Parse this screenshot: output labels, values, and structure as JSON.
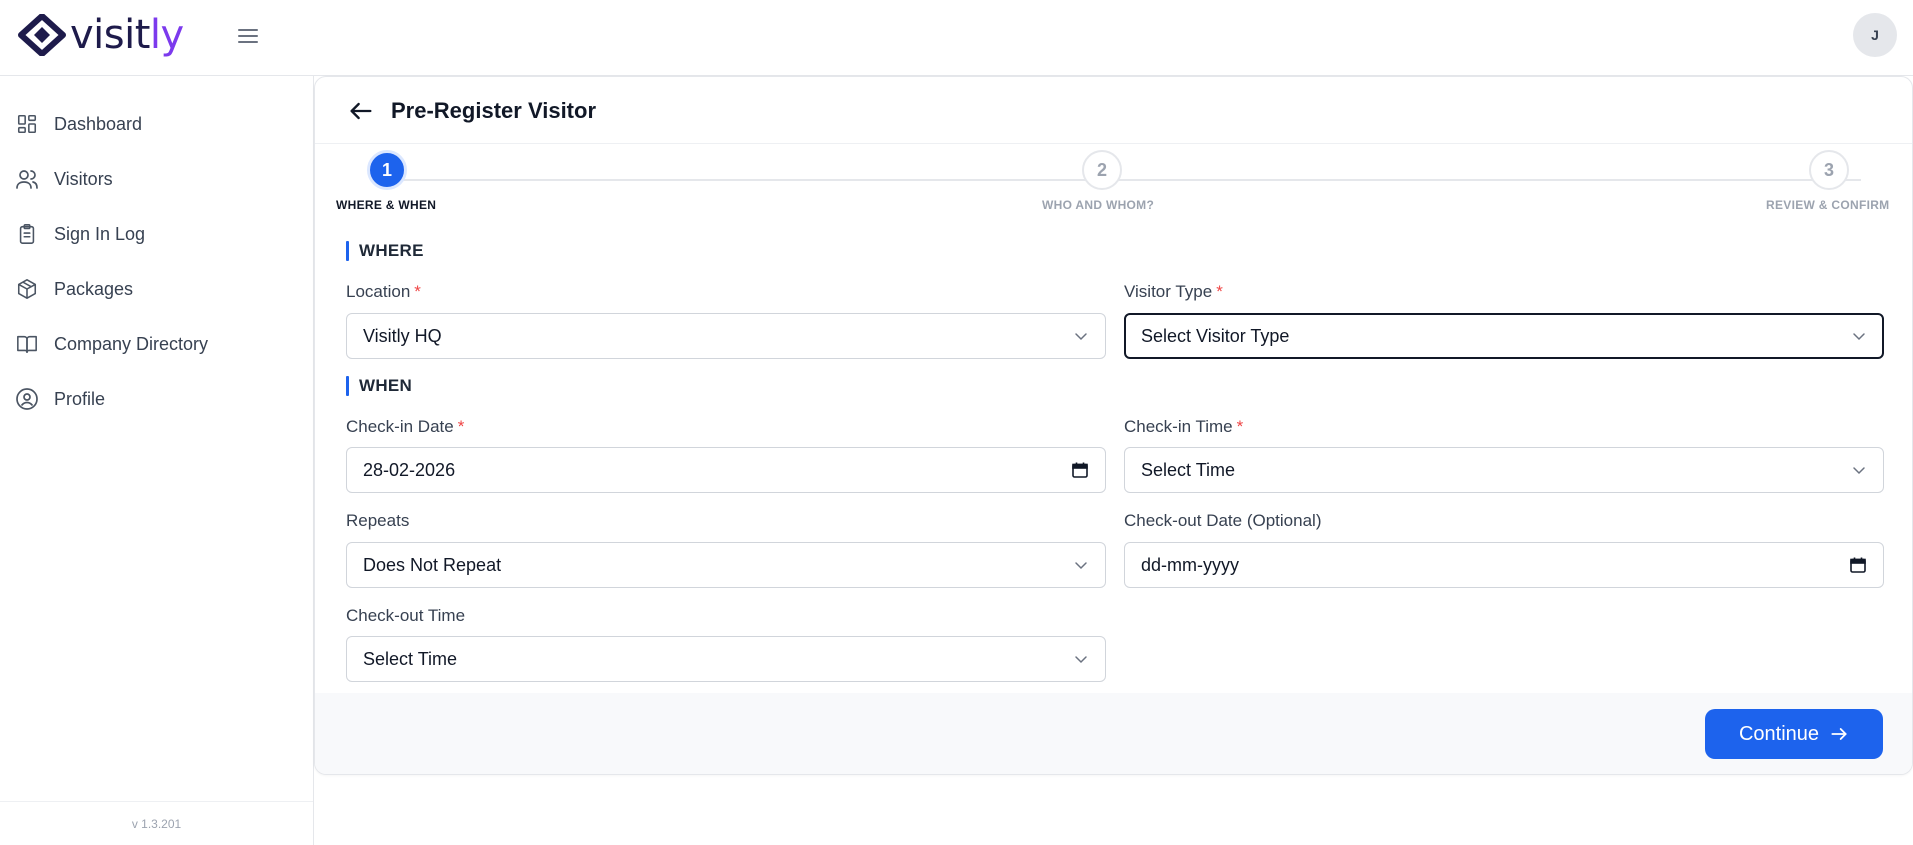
{
  "brand": {
    "name_main": "visit",
    "name_accent": "ly",
    "colors": {
      "navy": "#1e1b4b",
      "accent": "#7c3aed",
      "primary": "#1d63ed"
    }
  },
  "header": {
    "avatar_initial": "J"
  },
  "sidebar": {
    "items": [
      {
        "label": "Dashboard",
        "icon": "dashboard-icon"
      },
      {
        "label": "Visitors",
        "icon": "users-icon"
      },
      {
        "label": "Sign In Log",
        "icon": "clipboard-icon"
      },
      {
        "label": "Packages",
        "icon": "package-icon"
      },
      {
        "label": "Company Directory",
        "icon": "book-icon"
      },
      {
        "label": "Profile",
        "icon": "user-circle-icon"
      }
    ],
    "version": "v 1.3.201"
  },
  "page": {
    "title": "Pre-Register Visitor"
  },
  "stepper": {
    "current": 1,
    "steps": [
      {
        "number": "1",
        "label": "WHERE & WHEN"
      },
      {
        "number": "2",
        "label": "WHO AND WHOM?"
      },
      {
        "number": "3",
        "label": "REVIEW & CONFIRM"
      }
    ]
  },
  "form": {
    "sections": {
      "where": "WHERE",
      "when": "WHEN"
    },
    "location": {
      "label": "Location",
      "required": "*",
      "value": "Visitly HQ"
    },
    "visitor_type": {
      "label": "Visitor Type",
      "required": "*",
      "value": "Select Visitor Type"
    },
    "checkin_date": {
      "label": "Check-in Date",
      "required": "*",
      "value": "28-02-2026"
    },
    "checkin_time": {
      "label": "Check-in Time",
      "required": "*",
      "value": "Select Time"
    },
    "repeats": {
      "label": "Repeats",
      "value": "Does Not Repeat"
    },
    "checkout_date": {
      "label": "Check-out Date (Optional)",
      "value": "dd-mm-yyyy"
    },
    "checkout_time": {
      "label": "Check-out Time",
      "value": "Select Time"
    }
  },
  "footer": {
    "continue_label": "Continue"
  }
}
